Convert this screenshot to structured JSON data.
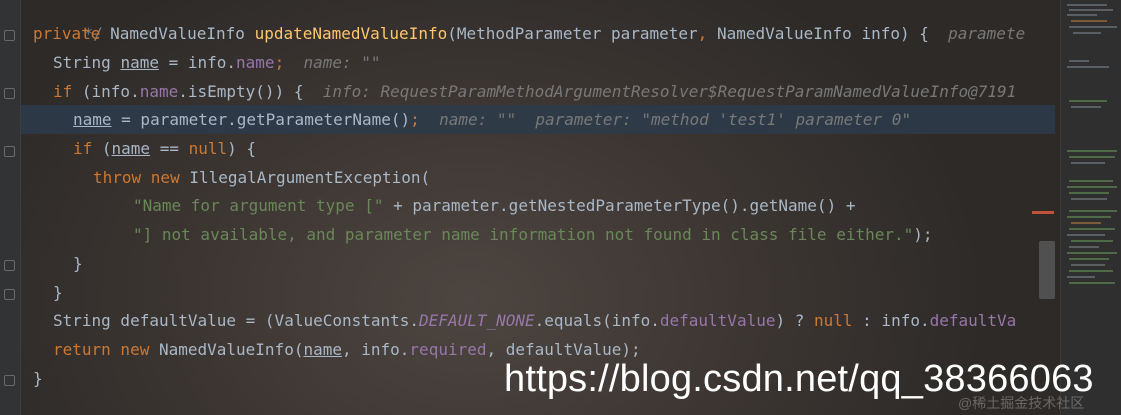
{
  "code": {
    "line_comment_end": "*/",
    "l1": {
      "kw": "private",
      "t1": " NamedValueInfo ",
      "fn": "updateNamedValueInfo",
      "t2": "(MethodParameter parameter",
      "c1": ",",
      "t3": " NamedValueInfo info) {",
      "hint": "paramete"
    },
    "l2": {
      "t1": "String ",
      "var": "name",
      "t2": " = info.",
      "field": "name",
      "semi": ";",
      "hint": "name: \"\""
    },
    "l3": {
      "kw": "if",
      "t1": " (info.",
      "field": "name",
      "t2": ".isEmpty()) {",
      "hint": "info: RequestParamMethodArgumentResolver$RequestParamNamedValueInfo@7191"
    },
    "l4": {
      "var": "name",
      "t1": " = parameter.getParameterName()",
      "semi": ";",
      "hint1": "name: \"\"",
      "hint2": "parameter: \"method 'test1' parameter 0\""
    },
    "l5": {
      "kw": "if",
      "t1": " (",
      "var": "name",
      "t2": " == ",
      "kw2": "null",
      "t3": ") {"
    },
    "l6": {
      "kw": "throw new",
      "t1": " IllegalArgumentException("
    },
    "l7": {
      "str": "\"Name for argument type [\"",
      "t1": " + parameter.getNestedParameterType().getName() +"
    },
    "l8": {
      "str": "\"] not available, and parameter name information not found in class file either.\"",
      "t1": ");"
    },
    "l9": "}",
    "l10": "}",
    "l11": {
      "t1": "String defaultValue = (ValueConstants.",
      "const": "DEFAULT_NONE",
      "t2": ".equals(info.",
      "field": "defaultValue",
      "t3": ") ? ",
      "kw": "null",
      "t4": " : info.",
      "field2": "defaultVa"
    },
    "l12": {
      "kw": "return new",
      "t1": " NamedValueInfo(",
      "var": "name",
      "t2": ", info.",
      "field": "required",
      "t3": ", defaultValue);"
    },
    "l13": "}"
  },
  "watermark": {
    "url": "https://blog.csdn.net/qq_38366063",
    "sub": "@稀土掘金技术社区"
  },
  "colors": {
    "keyword": "#cc7832",
    "method": "#ffc66d",
    "field": "#9876aa",
    "string": "#6a8759",
    "text": "#a9b7c6",
    "hint": "#787878",
    "highlight": "#2d3b4b"
  }
}
